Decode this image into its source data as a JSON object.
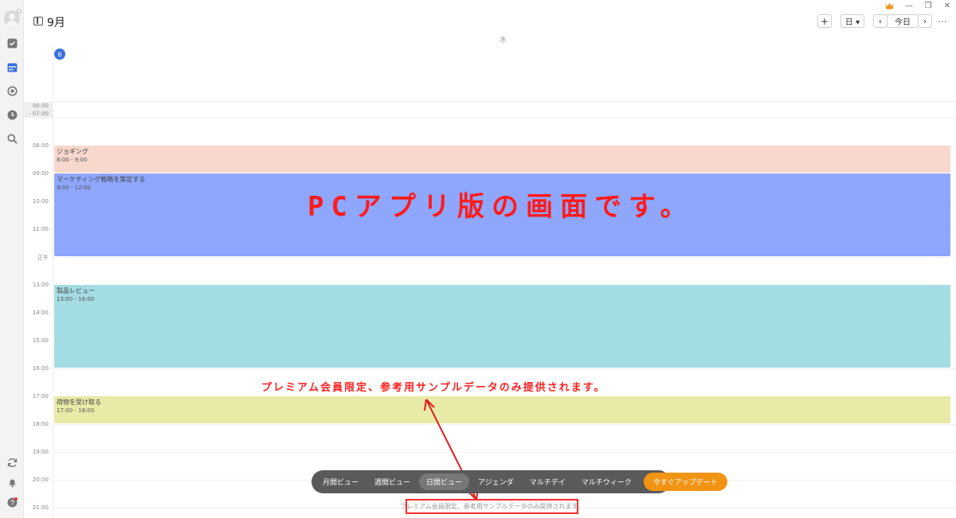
{
  "header": {
    "month": "9月",
    "add_label": "+",
    "view_select": "日 ▾",
    "prev_label": "‹",
    "today_label": "今日",
    "next_label": "›",
    "more_label": "⋯",
    "weekday": "水"
  },
  "window_controls": {
    "minimize": "—",
    "restore": "❐",
    "close": "✕"
  },
  "calendar": {
    "date": "6",
    "collapsed_start": "00:00",
    "collapsed_end": "- 07:00",
    "hours": [
      "08:00",
      "09:00",
      "10:00",
      "11:00",
      "正午",
      "13:00",
      "14:00",
      "15:00",
      "16:00",
      "17:00",
      "18:00",
      "19:00",
      "20:00",
      "21:00"
    ],
    "events": [
      {
        "title": "ジョギング",
        "time": "8:00 - 9:00",
        "color": "#f8d7cd"
      },
      {
        "title": "マーケティング戦略を策定する",
        "time": "9:00 - 12:00",
        "color": "#8ea6fc"
      },
      {
        "title": "製品レビュー",
        "time": "13:00 - 16:00",
        "color": "#a4dce3"
      },
      {
        "title": "荷物を受け取る",
        "time": "17:00 - 18:00",
        "color": "#e8eaa7"
      }
    ]
  },
  "overlay": {
    "title": "PCアプリ版の画面です。",
    "note": "プレミアム会員限定、参考用サンプルデータのみ提供されます。"
  },
  "view_switcher": {
    "items": [
      "月間ビュー",
      "週間ビュー",
      "日間ビュー",
      "アジェンダ",
      "マルチデイ",
      "マルチウィーク"
    ],
    "active": "日間ビュー",
    "upgrade": "今すぐアップデート"
  },
  "footer_note": "プレミアム会員限定、参考用サンプルデータのみ提供されます。",
  "colors": {
    "accent": "#3b6fe0",
    "upgrade": "#f29413",
    "annotation": "#ff1b1b"
  }
}
